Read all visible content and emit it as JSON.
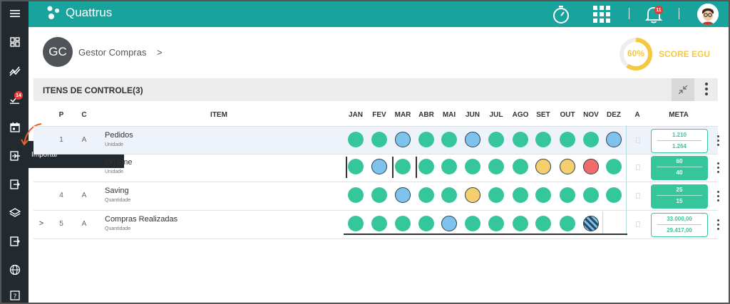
{
  "app": {
    "name": "Quattrus"
  },
  "topbar": {
    "notification_count": "11"
  },
  "sidebar": {
    "items": [
      "menu",
      "dashboard",
      "trends",
      "tasks",
      "calendar",
      "import",
      "export",
      "layers",
      "export2",
      "globe",
      "help"
    ],
    "tasks_badge": "14"
  },
  "tooltip": {
    "label": "Importar"
  },
  "user": {
    "initials": "GC",
    "name": "Gestor Compras",
    "chevron": ">"
  },
  "score": {
    "percent": "60%",
    "label": "SCORE EGU",
    "value": 0.6
  },
  "section": {
    "title": "ITENS DE CONTROLE(3)"
  },
  "table": {
    "headers": {
      "p": "P",
      "c": "C",
      "item": "ITEM",
      "a": "A",
      "meta": "META"
    },
    "months": [
      "JAN",
      "FEV",
      "MAR",
      "ABR",
      "MAI",
      "JUN",
      "JUL",
      "AGO",
      "SET",
      "OUT",
      "NOV",
      "DEZ"
    ],
    "rows": [
      {
        "p": "1",
        "c": "A",
        "title": "Pedidos",
        "subtitle": "Unidade",
        "statuses": [
          "green",
          "green",
          "blue",
          "green",
          "green",
          "blue",
          "green",
          "green",
          "green",
          "green",
          "green",
          "blue"
        ],
        "meta_top": "1.210",
        "meta_bottom": "1.264",
        "meta_style": "outline",
        "expand": ""
      },
      {
        "p": "",
        "c": "",
        "title": "On time",
        "subtitle": "Unidade",
        "statuses": [
          "green",
          "blue",
          "green",
          "green",
          "green",
          "green",
          "green",
          "green",
          "yellow",
          "yellow",
          "red",
          "green"
        ],
        "meta_top": "60",
        "meta_bottom": "40",
        "meta_style": "solid",
        "expand": ""
      },
      {
        "p": "4",
        "c": "A",
        "title": "Saving",
        "subtitle": "Quantidade",
        "statuses": [
          "green",
          "green",
          "blue",
          "green",
          "green",
          "yellow",
          "green",
          "green",
          "green",
          "green",
          "green",
          "green"
        ],
        "meta_top": "25",
        "meta_bottom": "15",
        "meta_style": "solid",
        "expand": ""
      },
      {
        "p": "5",
        "c": "A",
        "title": "Compras Realizadas",
        "subtitle": "Quantidade",
        "statuses": [
          "green",
          "green",
          "green",
          "green",
          "blue",
          "green",
          "green",
          "green",
          "green",
          "green",
          "striped",
          ""
        ],
        "meta_top": "33.000,00",
        "meta_bottom": "29.417,00",
        "meta_style": "outline",
        "expand": ">"
      }
    ]
  },
  "colors": {
    "teal": "#18a39d",
    "green": "#35c79b",
    "blue": "#7ec3ec",
    "yellow": "#f5cf6b",
    "red": "#f26b6b",
    "sidebar": "#22292f",
    "score": "#f5c842"
  }
}
